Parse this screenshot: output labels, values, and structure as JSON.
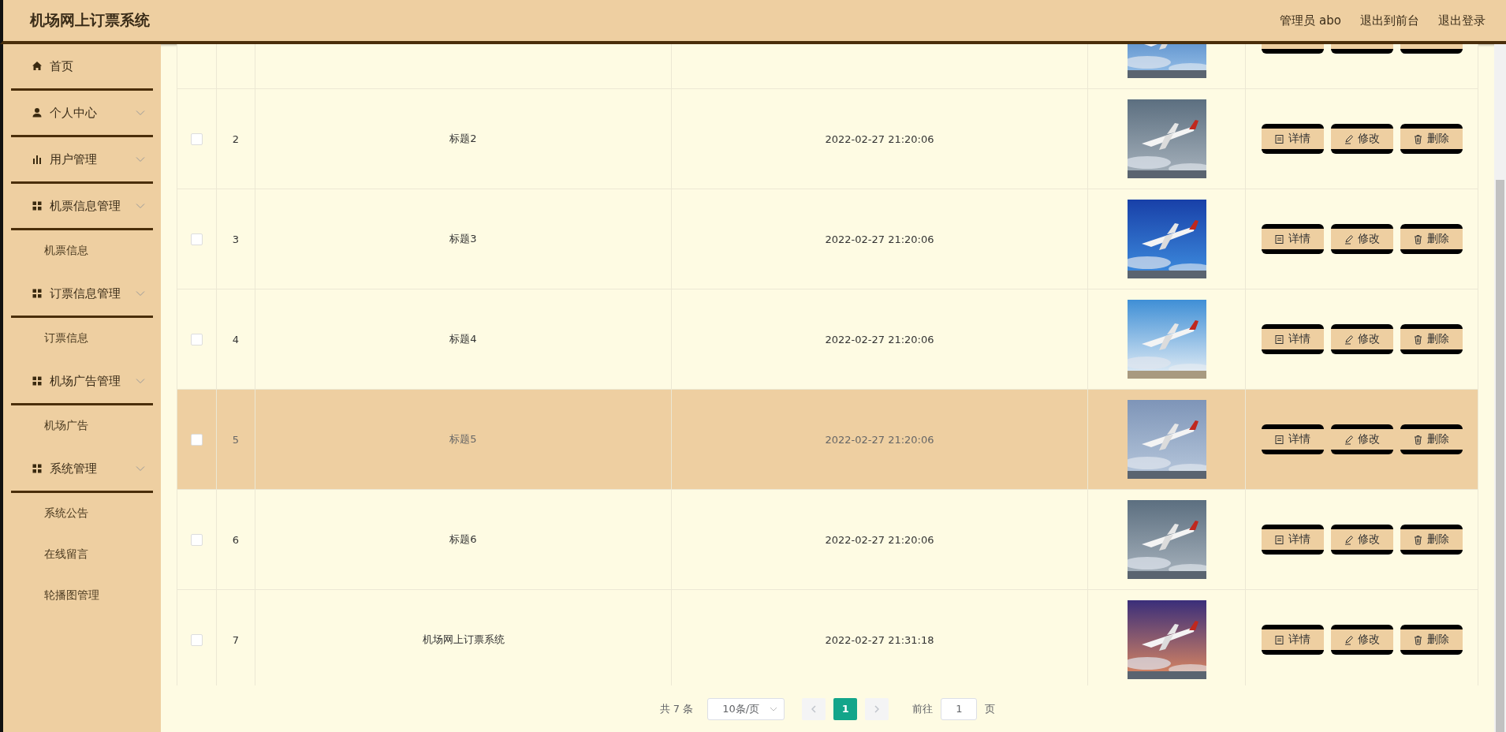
{
  "header": {
    "title": "机场网上订票系统",
    "links": [
      "管理员 abo",
      "退出到前台",
      "退出登录"
    ]
  },
  "sidebar": {
    "items": [
      {
        "kind": "link",
        "label": "首页"
      },
      {
        "kind": "group",
        "label": "个人中心"
      },
      {
        "kind": "group",
        "label": "用户管理"
      },
      {
        "kind": "group",
        "label": "机票信息管理",
        "children": [
          {
            "label": "机票信息"
          }
        ]
      },
      {
        "kind": "group",
        "label": "订票信息管理",
        "children": [
          {
            "label": "订票信息"
          }
        ]
      },
      {
        "kind": "group",
        "label": "机场广告管理",
        "children": [
          {
            "label": "机场广告"
          }
        ]
      },
      {
        "kind": "group",
        "label": "系统管理",
        "children": [
          {
            "label": "系统公告"
          },
          {
            "label": "在线留言"
          },
          {
            "label": "轮播图管理"
          }
        ]
      }
    ]
  },
  "table": {
    "rows": [
      {
        "kind": "cut_off",
        "highlighted": false
      },
      {
        "kind": "full",
        "highlighted": false,
        "checked": false,
        "index": "2",
        "title": "标题2",
        "time": "2022-02-27 21:20:06",
        "actions": [
          "详情",
          "修改",
          "删除"
        ]
      },
      {
        "kind": "full",
        "highlighted": false,
        "checked": false,
        "index": "3",
        "title": "标题3",
        "time": "2022-02-27 21:20:06",
        "actions": [
          "详情",
          "修改",
          "删除"
        ]
      },
      {
        "kind": "full",
        "highlighted": false,
        "checked": false,
        "index": "4",
        "title": "标题4",
        "time": "2022-02-27 21:20:06",
        "actions": [
          "详情",
          "修改",
          "删除"
        ]
      },
      {
        "kind": "full",
        "highlighted": true,
        "checked": false,
        "index": "5",
        "title": "标题5",
        "time": "2022-02-27 21:20:06",
        "actions": [
          "详情",
          "修改",
          "删除"
        ]
      },
      {
        "kind": "full",
        "highlighted": false,
        "checked": false,
        "index": "6",
        "title": "标题6",
        "time": "2022-02-27 21:20:06",
        "actions": [
          "详情",
          "修改",
          "删除"
        ]
      },
      {
        "kind": "full",
        "highlighted": false,
        "checked": false,
        "index": "7",
        "title": "机场网上订票系统",
        "time": "2022-02-27 21:31:18",
        "actions": [
          "详情",
          "修改",
          "删除"
        ]
      }
    ]
  },
  "pagination": {
    "total": "共 7 条",
    "page_size": "10条/页",
    "pages": [
      {
        "label": "1",
        "selected": true
      }
    ],
    "goto_label": "前往",
    "goto_value": "1",
    "goto_suffix": "页"
  }
}
